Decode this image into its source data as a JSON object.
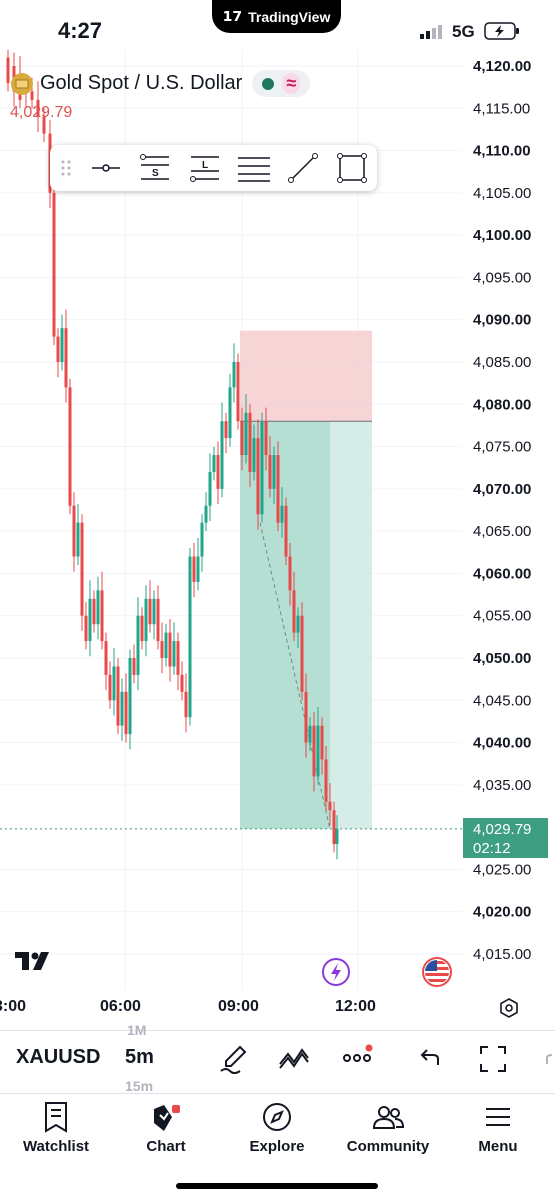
{
  "status": {
    "time": "4:27",
    "network": "5G",
    "app_pill": "TradingView"
  },
  "header": {
    "symbol_title": "Gold Spot / U.S. Dollar",
    "last_price": "4,029.79"
  },
  "drawing_toolbar": {
    "tools": [
      "grip-handle",
      "horizontal-ray",
      "short-position",
      "long-position",
      "horizontal-lines",
      "trend-line",
      "rectangle"
    ],
    "short_label": "S",
    "long_label": "L"
  },
  "chart": {
    "price_labels": [
      "4,120.00",
      "4,115.00",
      "4,110.00",
      "4,105.00",
      "4,100.00",
      "4,095.00",
      "4,090.00",
      "4,085.00",
      "4,080.00",
      "4,075.00",
      "4,070.00",
      "4,065.00",
      "4,060.00",
      "4,055.00",
      "4,050.00",
      "4,045.00",
      "4,040.00",
      "4,035.00",
      "4,025.00",
      "4,020.00",
      "4,015.00"
    ],
    "bold_labels": [
      "4,120.00",
      "4,110.00",
      "4,100.00",
      "4,090.00",
      "4,080.00",
      "4,070.00",
      "4,060.00",
      "4,050.00",
      "4,040.00",
      "4,020.00"
    ],
    "current_price_tag": "4,029.79",
    "countdown": "02:12",
    "time_labels": [
      "3:00",
      "06:00",
      "09:00",
      "12:00"
    ],
    "colors": {
      "up": "#22a68a",
      "down": "#e84a4a",
      "stop_zone": "#f4c7c9",
      "target_zone": "#a9d9cc",
      "target_zone_light": "#d6ece6",
      "price_line": "#3d9e82"
    }
  },
  "toolbar": {
    "symbol": "XAUUSD",
    "timeframe": "5m",
    "timeframe_prev": "1M",
    "timeframe_next": "15m"
  },
  "nav": {
    "watchlist": "Watchlist",
    "chart": "Chart",
    "explore": "Explore",
    "community": "Community",
    "menu": "Menu"
  }
}
